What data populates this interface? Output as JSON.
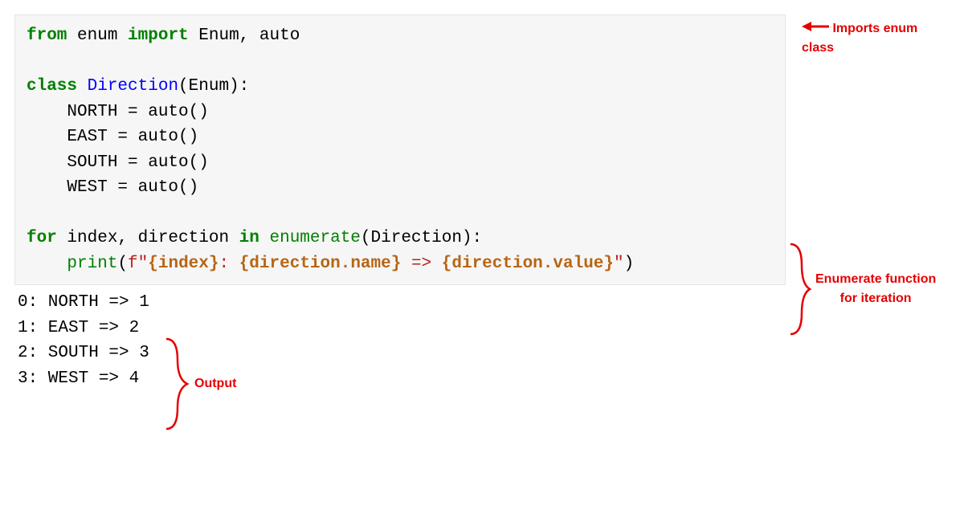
{
  "code": {
    "line1": {
      "kw1": "from",
      "mod": " enum ",
      "kw2": "import",
      "rest": " Enum, auto"
    },
    "line3": {
      "kw": "class",
      "sp": " ",
      "cls": "Direction",
      "rest": "(Enum):"
    },
    "line4": "    NORTH = auto()",
    "line5": "    EAST = auto()",
    "line6": "    SOUTH = auto()",
    "line7": "    WEST = auto()",
    "line9": {
      "kw1": "for",
      "mid": " index, direction ",
      "kw2": "in",
      "sp": " ",
      "func": "enumerate",
      "rest": "(Direction):"
    },
    "line10": {
      "indent": "    ",
      "func": "print",
      "open": "(",
      "prefix": "f\"",
      "i1": "{index}",
      "s1": ": ",
      "i2": "{direction.name}",
      "s2": " => ",
      "i3": "{direction.value}",
      "suffix": "\"",
      "close": ")"
    }
  },
  "output": {
    "l1": "0: NORTH => 1",
    "l2": "1: EAST => 2",
    "l3": "2: SOUTH => 3",
    "l4": "3: WEST => 4"
  },
  "annotations": {
    "imports": "Imports enum class",
    "enumerate1": "Enumerate function",
    "enumerate2": "for iteration",
    "output": "Output"
  },
  "colors": {
    "annotation": "#e60000"
  }
}
